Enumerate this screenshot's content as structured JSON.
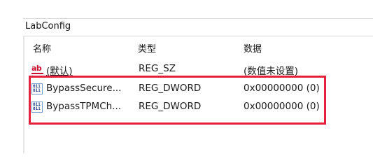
{
  "address": {
    "path": "LabConfig"
  },
  "columns": {
    "name": "名称",
    "type": "类型",
    "data": "数据"
  },
  "rows": [
    {
      "icon": "string-value-icon",
      "icon_glyph": "ab",
      "name": "(默认)",
      "type": "REG_SZ",
      "data": "(数值未设置)"
    },
    {
      "icon": "binary-value-icon",
      "icon_glyph": "011",
      "name": "BypassSecure...",
      "type": "REG_DWORD",
      "data": "0x00000000 (0)"
    },
    {
      "icon": "binary-value-icon",
      "icon_glyph": "011",
      "name": "BypassTPMCh...",
      "type": "REG_DWORD",
      "data": "0x00000000 (0)"
    }
  ],
  "colors": {
    "highlight_border": "#e5223d",
    "string_icon": "#c8102e",
    "binary_icon": "#1f3d8a"
  }
}
